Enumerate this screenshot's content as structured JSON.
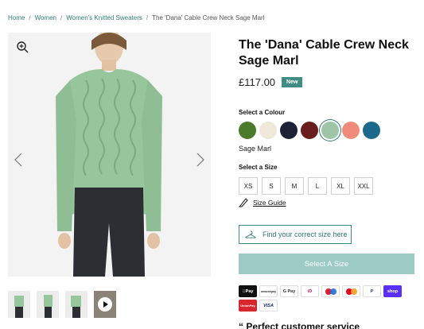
{
  "breadcrumb": {
    "items": [
      "Home",
      "Women",
      "Women's Knitted Sweaters"
    ],
    "current": "The 'Dana' Cable Crew Neck Sage Marl"
  },
  "gallery": {
    "thumb_count": 4,
    "video_thumb_index": 3
  },
  "product": {
    "title": "The 'Dana' Cable Crew Neck Sage Marl",
    "price": "£117.00",
    "badge": "New"
  },
  "colour": {
    "label": "Select a Colour",
    "selected_name": "Sage Marl",
    "swatches": [
      {
        "icon": "swatch-green",
        "color": "#4a7a2c"
      },
      {
        "icon": "swatch-cream",
        "color": "#efe8d8"
      },
      {
        "icon": "swatch-navy",
        "color": "#1c2233"
      },
      {
        "icon": "swatch-wine",
        "color": "#6b1d1d"
      },
      {
        "icon": "swatch-sage",
        "color": "#9ec5a6",
        "selected": true
      },
      {
        "icon": "swatch-coral",
        "color": "#f08b7a"
      },
      {
        "icon": "swatch-teal",
        "color": "#1b6a8c"
      }
    ]
  },
  "size": {
    "label": "Select a Size",
    "options": [
      "XS",
      "S",
      "M",
      "L",
      "XL",
      "XXL"
    ],
    "guide_label": "Size Guide",
    "find_label": "Find your correct size here"
  },
  "cta": {
    "select_label": "Select A Size"
  },
  "payments": {
    "applepay": "Pay",
    "amazonpay": "amazonpay",
    "gpay": "G Pay",
    "ideal": "iD",
    "paypal": "P",
    "shop": "shop",
    "unionpay": "UnionPay",
    "visa": "VISA"
  },
  "footer": {
    "perfect": "Perfect customer service"
  },
  "colors": {
    "accent": "#3e8c82",
    "link": "#2f7d73",
    "cta_disabled": "#9ccbc4"
  }
}
